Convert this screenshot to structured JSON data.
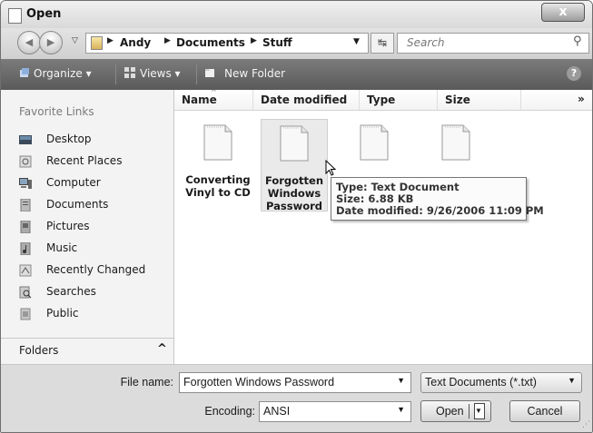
{
  "window": {
    "title": "Open",
    "close_label": "x"
  },
  "address_bar": {
    "breadcrumbs": [
      "Andy",
      "Documents",
      "Stuff"
    ],
    "search_placeholder": "Search"
  },
  "toolbar": {
    "organize": "Organize",
    "views": "Views",
    "new_folder": "New Folder",
    "help": "?"
  },
  "favorites": {
    "heading": "Favorite Links",
    "items": [
      {
        "label": "Desktop",
        "icon": "desktop-icon"
      },
      {
        "label": "Recent Places",
        "icon": "recent-places-icon"
      },
      {
        "label": "Computer",
        "icon": "computer-icon"
      },
      {
        "label": "Documents",
        "icon": "documents-icon"
      },
      {
        "label": "Pictures",
        "icon": "pictures-icon"
      },
      {
        "label": "Music",
        "icon": "music-icon"
      },
      {
        "label": "Recently Changed",
        "icon": "recently-changed-icon"
      },
      {
        "label": "Searches",
        "icon": "searches-icon"
      },
      {
        "label": "Public",
        "icon": "public-icon"
      }
    ],
    "folders_label": "Folders",
    "folders_chevron": "^"
  },
  "columns": {
    "name": "Name",
    "date_modified": "Date modified",
    "type": "Type",
    "size": "Size",
    "more": "»"
  },
  "files": [
    {
      "line1": "Converting",
      "line2": "Vinyl to CD",
      "line3": ""
    },
    {
      "line1": "Forgotten",
      "line2": "Windows",
      "line3": "Password"
    },
    {
      "line1": "",
      "line2": "",
      "line3": ""
    },
    {
      "line1": "",
      "line2": "",
      "line3": ""
    }
  ],
  "tooltip": {
    "type": "Type: Text Document",
    "size": "Size: 6.88 KB",
    "date": "Date modified: 9/26/2006 11:09 PM"
  },
  "bottom": {
    "file_name_label": "File name:",
    "file_name_value": "Forgotten Windows Password",
    "file_type_value": "Text Documents (*.txt)",
    "encoding_label": "Encoding:",
    "encoding_value": "ANSI",
    "open_label": "Open",
    "cancel_label": "Cancel"
  }
}
